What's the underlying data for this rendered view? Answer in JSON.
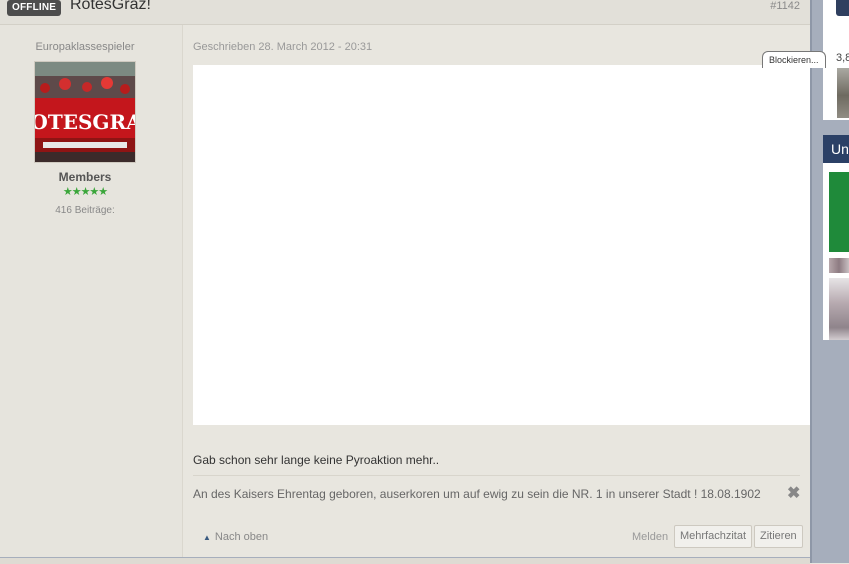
{
  "post": {
    "status_badge": "OFFLINE",
    "author_name": "RotesGraz!",
    "post_number": "#1142",
    "date": "Geschrieben 28. March 2012 - 20:31",
    "text": "Gab schon sehr lange keine Pyroaktion mehr..",
    "signature": "An des Kaisers Ehrentag geboren, auserkoren um auf ewig zu sein die NR. 1 in unserer Stadt ! 18.08.1902"
  },
  "author": {
    "title": "Europaklassespieler",
    "avatar_text": "ROTESGRAZ",
    "group": "Members",
    "stars": "★★★★★",
    "post_count": "416 Beiträge:"
  },
  "actions": {
    "scroll_top": "Nach oben",
    "report": "Melden",
    "multiquote": "Mehrfachzitat",
    "quote": "Zitieren"
  },
  "overlay": {
    "block_label": "Blockieren..."
  },
  "sidebar": {
    "count_text": "3,8",
    "section_header": "Un"
  },
  "colors": {
    "background": "#e8e6df",
    "badge": "#4d4d4d",
    "stars": "#3aa63a",
    "sidebar_header": "#2b4066",
    "sidebar_green": "#1f8a3a"
  }
}
